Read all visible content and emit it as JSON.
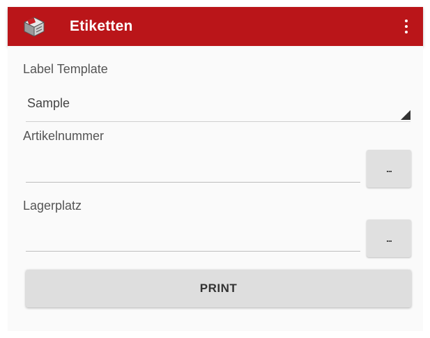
{
  "app_bar": {
    "title": "Etiketten",
    "icon": "warehouse-box-icon",
    "overflow_icon": "more-vertical-icon",
    "background_color": "#ba1519"
  },
  "form": {
    "label_template": {
      "label": "Label Template",
      "selected_value": "Sample"
    },
    "article_number": {
      "label": "Artikelnummer",
      "value": "",
      "button_label": "..."
    },
    "storage_location": {
      "label": "Lagerplatz",
      "value": "",
      "button_label": "..."
    },
    "print_button_label": "PRINT"
  }
}
